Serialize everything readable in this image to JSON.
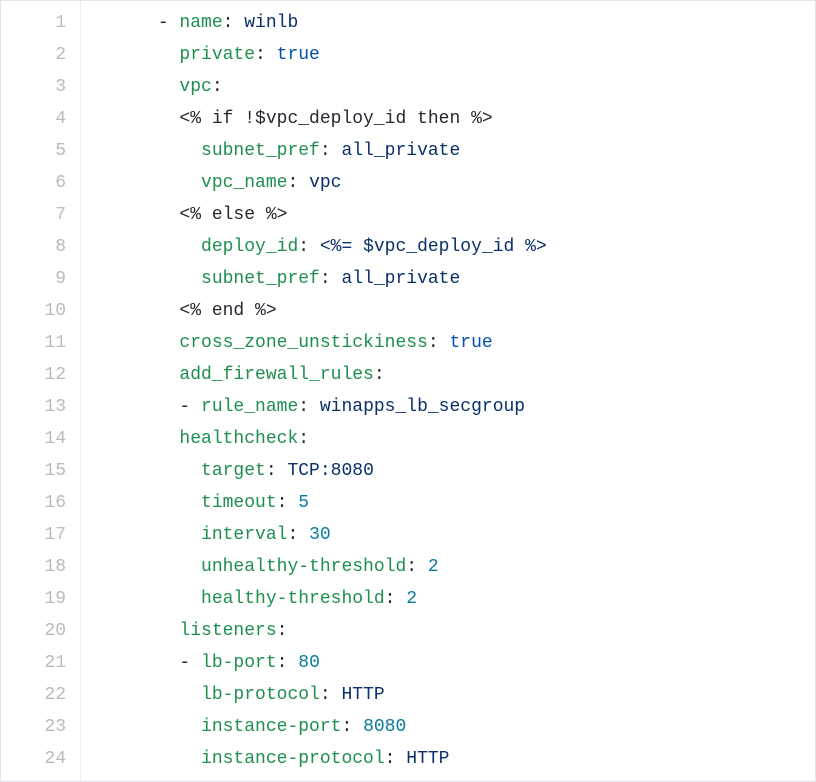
{
  "lines": [
    {
      "num": "1",
      "indent": "      ",
      "tokens": [
        {
          "t": "- ",
          "c": "tok-plain"
        },
        {
          "t": "name",
          "c": "tok-key"
        },
        {
          "t": ": ",
          "c": "tok-punc"
        },
        {
          "t": "winlb",
          "c": "tok-str"
        }
      ]
    },
    {
      "num": "2",
      "indent": "        ",
      "tokens": [
        {
          "t": "private",
          "c": "tok-key"
        },
        {
          "t": ": ",
          "c": "tok-punc"
        },
        {
          "t": "true",
          "c": "tok-bool"
        }
      ]
    },
    {
      "num": "3",
      "indent": "        ",
      "tokens": [
        {
          "t": "vpc",
          "c": "tok-key"
        },
        {
          "t": ":",
          "c": "tok-punc"
        }
      ]
    },
    {
      "num": "4",
      "indent": "        ",
      "tokens": [
        {
          "t": "<% if !$vpc_deploy_id then %>",
          "c": "tok-plain"
        }
      ]
    },
    {
      "num": "5",
      "indent": "          ",
      "tokens": [
        {
          "t": "subnet_pref",
          "c": "tok-key"
        },
        {
          "t": ": ",
          "c": "tok-punc"
        },
        {
          "t": "all_private",
          "c": "tok-str"
        }
      ]
    },
    {
      "num": "6",
      "indent": "          ",
      "tokens": [
        {
          "t": "vpc_name",
          "c": "tok-key"
        },
        {
          "t": ": ",
          "c": "tok-punc"
        },
        {
          "t": "vpc",
          "c": "tok-str"
        }
      ]
    },
    {
      "num": "7",
      "indent": "        ",
      "tokens": [
        {
          "t": "<% else %>",
          "c": "tok-plain"
        }
      ]
    },
    {
      "num": "8",
      "indent": "          ",
      "tokens": [
        {
          "t": "deploy_id",
          "c": "tok-key"
        },
        {
          "t": ": ",
          "c": "tok-punc"
        },
        {
          "t": "<%= $vpc_deploy_id %>",
          "c": "tok-str"
        }
      ]
    },
    {
      "num": "9",
      "indent": "          ",
      "tokens": [
        {
          "t": "subnet_pref",
          "c": "tok-key"
        },
        {
          "t": ": ",
          "c": "tok-punc"
        },
        {
          "t": "all_private",
          "c": "tok-str"
        }
      ]
    },
    {
      "num": "10",
      "indent": "        ",
      "tokens": [
        {
          "t": "<% end %>",
          "c": "tok-plain"
        }
      ]
    },
    {
      "num": "11",
      "indent": "        ",
      "tokens": [
        {
          "t": "cross_zone_unstickiness",
          "c": "tok-key"
        },
        {
          "t": ": ",
          "c": "tok-punc"
        },
        {
          "t": "true",
          "c": "tok-bool"
        }
      ]
    },
    {
      "num": "12",
      "indent": "        ",
      "tokens": [
        {
          "t": "add_firewall_rules",
          "c": "tok-key"
        },
        {
          "t": ":",
          "c": "tok-punc"
        }
      ]
    },
    {
      "num": "13",
      "indent": "        ",
      "tokens": [
        {
          "t": "- ",
          "c": "tok-plain"
        },
        {
          "t": "rule_name",
          "c": "tok-key"
        },
        {
          "t": ": ",
          "c": "tok-punc"
        },
        {
          "t": "winapps_lb_secgroup",
          "c": "tok-str"
        }
      ]
    },
    {
      "num": "14",
      "indent": "        ",
      "tokens": [
        {
          "t": "healthcheck",
          "c": "tok-key"
        },
        {
          "t": ":",
          "c": "tok-punc"
        }
      ]
    },
    {
      "num": "15",
      "indent": "          ",
      "tokens": [
        {
          "t": "target",
          "c": "tok-key"
        },
        {
          "t": ": ",
          "c": "tok-punc"
        },
        {
          "t": "TCP:8080",
          "c": "tok-str"
        }
      ]
    },
    {
      "num": "16",
      "indent": "          ",
      "tokens": [
        {
          "t": "timeout",
          "c": "tok-key"
        },
        {
          "t": ": ",
          "c": "tok-punc"
        },
        {
          "t": "5",
          "c": "tok-num"
        }
      ]
    },
    {
      "num": "17",
      "indent": "          ",
      "tokens": [
        {
          "t": "interval",
          "c": "tok-key"
        },
        {
          "t": ": ",
          "c": "tok-punc"
        },
        {
          "t": "30",
          "c": "tok-num"
        }
      ]
    },
    {
      "num": "18",
      "indent": "          ",
      "tokens": [
        {
          "t": "unhealthy-threshold",
          "c": "tok-key"
        },
        {
          "t": ": ",
          "c": "tok-punc"
        },
        {
          "t": "2",
          "c": "tok-num"
        }
      ]
    },
    {
      "num": "19",
      "indent": "          ",
      "tokens": [
        {
          "t": "healthy-threshold",
          "c": "tok-key"
        },
        {
          "t": ": ",
          "c": "tok-punc"
        },
        {
          "t": "2",
          "c": "tok-num"
        }
      ]
    },
    {
      "num": "20",
      "indent": "        ",
      "tokens": [
        {
          "t": "listeners",
          "c": "tok-key"
        },
        {
          "t": ":",
          "c": "tok-punc"
        }
      ]
    },
    {
      "num": "21",
      "indent": "        ",
      "tokens": [
        {
          "t": "- ",
          "c": "tok-plain"
        },
        {
          "t": "lb-port",
          "c": "tok-key"
        },
        {
          "t": ": ",
          "c": "tok-punc"
        },
        {
          "t": "80",
          "c": "tok-num"
        }
      ]
    },
    {
      "num": "22",
      "indent": "          ",
      "tokens": [
        {
          "t": "lb-protocol",
          "c": "tok-key"
        },
        {
          "t": ": ",
          "c": "tok-punc"
        },
        {
          "t": "HTTP",
          "c": "tok-str"
        }
      ]
    },
    {
      "num": "23",
      "indent": "          ",
      "tokens": [
        {
          "t": "instance-port",
          "c": "tok-key"
        },
        {
          "t": ": ",
          "c": "tok-punc"
        },
        {
          "t": "8080",
          "c": "tok-num"
        }
      ]
    },
    {
      "num": "24",
      "indent": "          ",
      "tokens": [
        {
          "t": "instance-protocol",
          "c": "tok-key"
        },
        {
          "t": ": ",
          "c": "tok-punc"
        },
        {
          "t": "HTTP",
          "c": "tok-str"
        }
      ]
    }
  ]
}
